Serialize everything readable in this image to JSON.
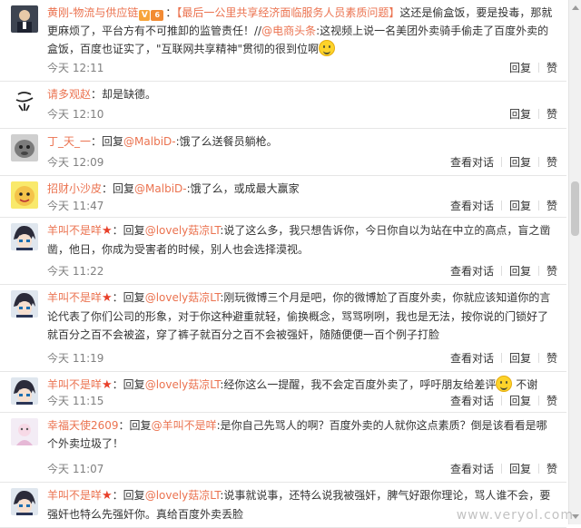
{
  "colors": {
    "accent": "#eb7350",
    "text": "#333333",
    "meta": "#808080",
    "badge_v": "#f7a43a",
    "star": "#e8402a"
  },
  "comments": [
    {
      "user": "黄刚-物流与供应链",
      "badge": "V",
      "level": "6",
      "segments": [
        {
          "t": "：",
          "k": "p"
        },
        {
          "t": "【最后一公里共享经济面临服务人员素质问题】",
          "k": "p"
        },
        {
          "t": "这还是偷盒饭，要是投毒，那就更麻烦了，平台方有不可推卸的监管责任！//",
          "k": "p"
        },
        {
          "t": "@电商头条",
          "k": "m"
        },
        {
          "t": ":这视频上说一名美团外卖骑手偷走了百度外卖的盒饭，百度也证实了，\"互联网共享精神\"贯彻的很到位啊",
          "k": "p"
        }
      ],
      "emoji": "grin-emoji",
      "time": "今天 12:11",
      "actions": [
        "回复",
        "赞"
      ]
    },
    {
      "user": "请多观赵",
      "segments": [
        {
          "t": "：却是缺德。",
          "k": "p"
        }
      ],
      "time": "今天 12:10",
      "actions": [
        "回复",
        "赞"
      ]
    },
    {
      "user": "丁_天_一",
      "segments": [
        {
          "t": "：回复",
          "k": "p"
        },
        {
          "t": "@MalbiD-",
          "k": "m"
        },
        {
          "t": ":饿了么送餐员躺枪。",
          "k": "p"
        }
      ],
      "time": "今天 12:09",
      "actions": [
        "查看对话",
        "回复",
        "赞"
      ]
    },
    {
      "user": "招财小沙皮",
      "segments": [
        {
          "t": "：回复",
          "k": "p"
        },
        {
          "t": "@MalbiD-",
          "k": "m"
        },
        {
          "t": ":饿了么，或成最大赢家",
          "k": "p"
        }
      ],
      "time": "今天 11:47",
      "actions": [
        "查看对话",
        "回复",
        "赞"
      ]
    },
    {
      "user": "羊叫不是咩",
      "star": "★",
      "segments": [
        {
          "t": "：回复",
          "k": "p"
        },
        {
          "t": "@lovely菇凉LT",
          "k": "m"
        },
        {
          "t": ":说了这么多，我只想告诉你，今日你自以为站在中立的高点，盲之凿凿，他日，你成为受害者的时候，别人也会选择漠视。",
          "k": "p"
        }
      ],
      "time": "今天 11:22",
      "actions": [
        "查看对话",
        "回复",
        "赞"
      ]
    },
    {
      "user": "羊叫不是咩",
      "star": "★",
      "segments": [
        {
          "t": "：回复",
          "k": "p"
        },
        {
          "t": "@lovely菇凉LT",
          "k": "m"
        },
        {
          "t": ":刚玩微博三个月是吧，你的微博尬了百度外卖，你就应该知道你的言论代表了你们公司的形象，对于你这种避重就轻，偷换概念，骂骂咧咧，我也是无法，按你说的门锁好了就百分之百不会被盗，穿了裤子就百分之百不会被强奸，随随便便一百个例子打脸",
          "k": "p"
        }
      ],
      "time": "今天 11:19",
      "actions": [
        "查看对话",
        "回复",
        "赞"
      ]
    },
    {
      "user": "羊叫不是咩",
      "star": "★",
      "segments": [
        {
          "t": "：回复",
          "k": "p"
        },
        {
          "t": "@lovely菇凉LT",
          "k": "m"
        },
        {
          "t": ":经你这么一提醒，我不会定百度外卖了，呼吁朋友给差评",
          "k": "p"
        }
      ],
      "emoji": "smile-emoji",
      "tail": "不谢",
      "time": "今天 11:15",
      "actions": [
        "查看对话",
        "回复",
        "赞"
      ]
    },
    {
      "user": "幸福天使2609",
      "segments": [
        {
          "t": "：回复",
          "k": "p"
        },
        {
          "t": "@羊叫不是咩",
          "k": "m"
        },
        {
          "t": ":是你自己先骂人的啊？百度外卖的人就你这点素质？倒是该看看是哪个外卖垃圾了！",
          "k": "p"
        }
      ],
      "time": "今天 11:07",
      "actions": [
        "查看对话",
        "回复",
        "赞"
      ]
    },
    {
      "user": "羊叫不是咩",
      "star": "★",
      "segments": [
        {
          "t": "：回复",
          "k": "p"
        },
        {
          "t": "@lovely菇凉LT",
          "k": "m"
        },
        {
          "t": ":说事就说事，还特么说我被强奸，脾气好跟你理论，骂人谁不会，要强奸也特么先强奸你。真给百度外卖丢脸",
          "k": "p"
        }
      ],
      "time": "",
      "actions": []
    }
  ],
  "watermark": "www.veryol.com"
}
